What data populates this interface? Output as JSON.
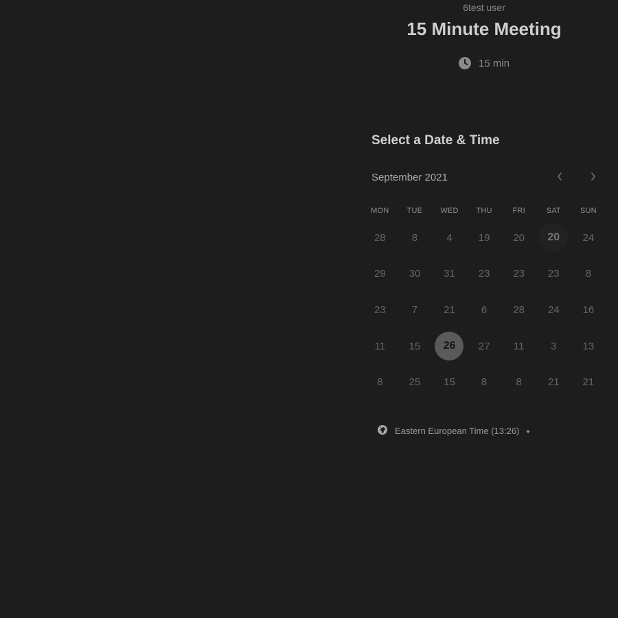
{
  "header": {
    "host_name": "6test user",
    "event_title": "15 Minute Meeting",
    "duration": "15 min",
    "duration_icon": "clock-icon"
  },
  "calendar": {
    "section_title": "Select a Date & Time",
    "month_label": "September 2021",
    "prev_icon": "chevron-left-icon",
    "next_icon": "chevron-right-icon",
    "weekdays": [
      "MON",
      "TUE",
      "WED",
      "THU",
      "FRI",
      "SAT",
      "SUN"
    ],
    "days": [
      [
        "28",
        "8",
        "4",
        "19",
        "20",
        "20",
        "24"
      ],
      [
        "29",
        "30",
        "31",
        "23",
        "23",
        "23",
        "8"
      ],
      [
        "23",
        "7",
        "21",
        "6",
        "28",
        "24",
        "16"
      ],
      [
        "11",
        "15",
        "26",
        "27",
        "11",
        "3",
        "13"
      ],
      [
        "8",
        "25",
        "15",
        "8",
        "8",
        "21",
        "21"
      ]
    ],
    "selected_day": "26",
    "today_day": "20"
  },
  "timezone": {
    "label": "Eastern European Time (13:26)",
    "icon": "globe-icon"
  },
  "colors": {
    "background": "#1d1d1d",
    "selected_circle": "#5a5a5a"
  }
}
